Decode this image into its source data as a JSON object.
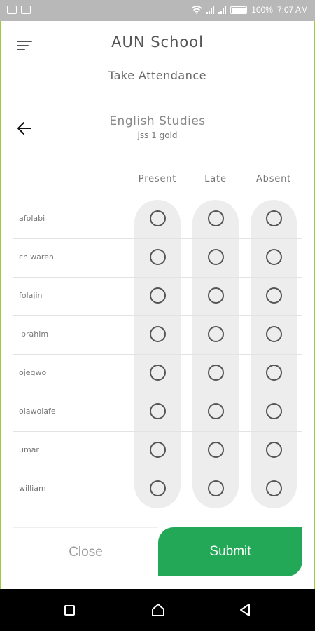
{
  "status_bar": {
    "battery": "100%",
    "time": "7:07 AM"
  },
  "header": {
    "app_title": "AUN School",
    "subtitle": "Take Attendance"
  },
  "course": {
    "title": "English Studies",
    "class": "jss 1 gold"
  },
  "columns": [
    "Present",
    "Late",
    "Absent"
  ],
  "students": [
    {
      "name": "afolabi"
    },
    {
      "name": "chiwaren"
    },
    {
      "name": "folajin"
    },
    {
      "name": "ibrahim"
    },
    {
      "name": "ojegwo"
    },
    {
      "name": "olawolafe"
    },
    {
      "name": "umar"
    },
    {
      "name": "william"
    }
  ],
  "buttons": {
    "close": "Close",
    "submit": "Submit"
  },
  "colors": {
    "accent": "#23a857",
    "frame": "#9ccc3c"
  }
}
